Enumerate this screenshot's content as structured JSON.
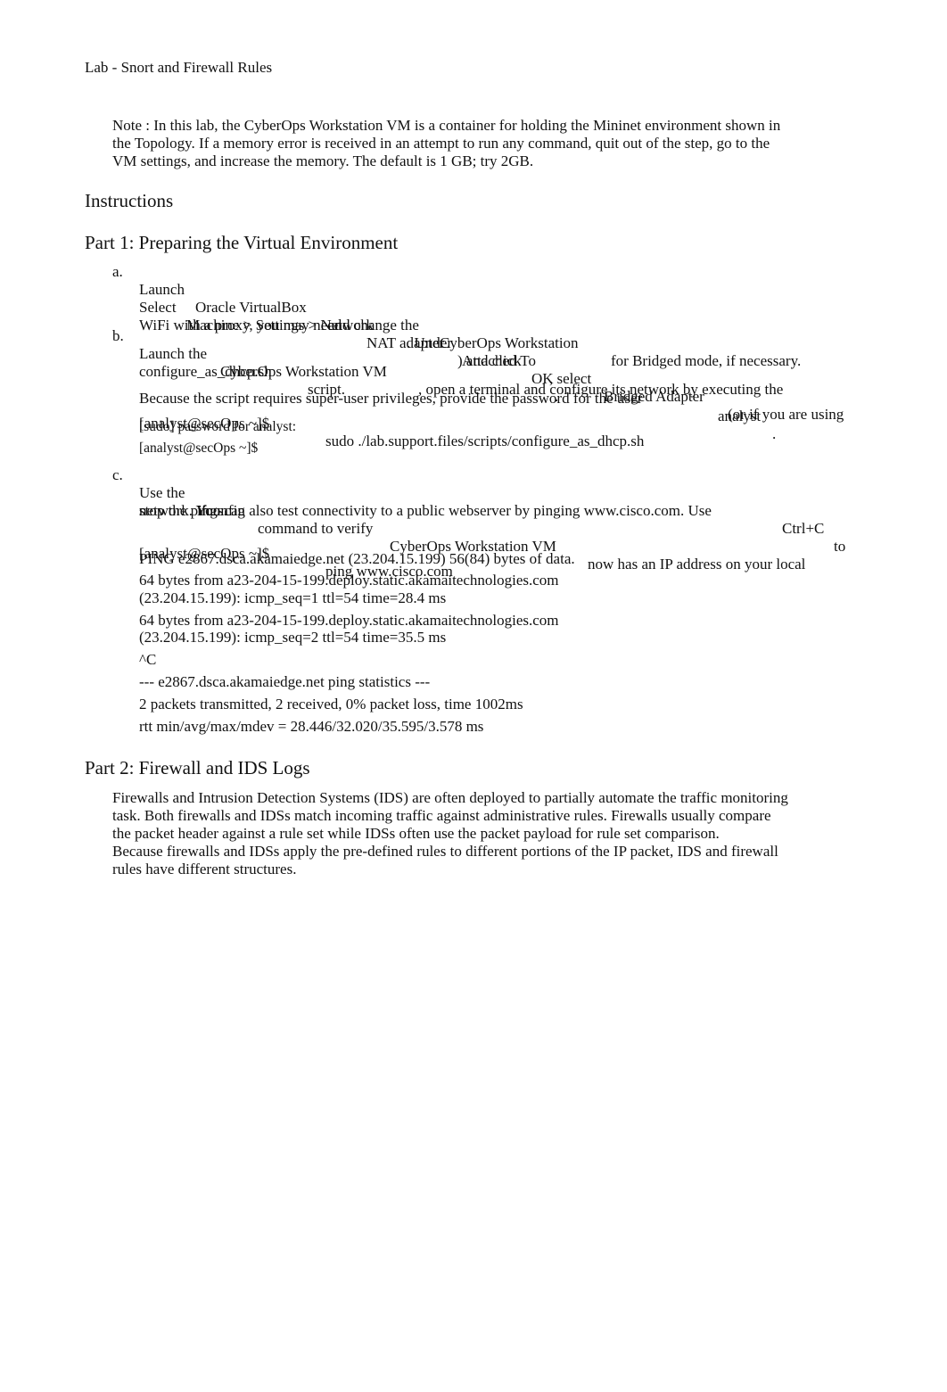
{
  "header": {
    "title": "Lab - Snort and Firewall Rules"
  },
  "note": {
    "lines": [
      "Note : In this lab, the CyberOps Workstation VM is a container for holding the Mininet environment shown in",
      "the Topology. If a memory error is received in an attempt to run any command, quit out of the step, go to the",
      "VM settings, and increase the memory. The default is 1 GB; try 2GB."
    ]
  },
  "instructions_heading": "Instructions",
  "part1": {
    "heading": "Part 1: Preparing the Virtual Environment",
    "step_a": {
      "marker": "a.",
      "line1": [
        "Launch",
        "Oracle VirtualBox",
        "and change the",
        "CyberOps Workstation",
        "for Bridged mode, if necessary."
      ],
      "line2": [
        "Select",
        "Machine > Settings > Network",
        ". Under",
        "Attached To",
        ", select",
        "Bridged Adapter",
        "(or if you are using"
      ],
      "line3": [
        "WiFi with a proxy, you may need",
        "NAT adapter",
        ") and click",
        "OK",
        "."
      ]
    },
    "step_b": {
      "marker": "b.",
      "line1": [
        "Launch the",
        "CyberOps Workstation VM",
        ", open a terminal and configure its network by executing the"
      ],
      "line2": [
        "configure_as_dhcp.sh",
        "script."
      ],
      "line3": [
        "Because the script requires super-user privileges, provide the password for the user",
        "analyst",
        "."
      ],
      "cmd_prompt": "[analyst@secOps ~]$",
      "cmd": "sudo ./lab.support.files/scripts/configure_as_dhcp.sh",
      "output1": "[sudo] password for analyst:",
      "output2": "[analyst@secOps ~]$"
    },
    "step_c": {
      "marker": "c.",
      "line1": [
        "Use the",
        "ifconfig",
        "command to verify",
        "CyberOps Workstation VM",
        "now has an IP address on your local"
      ],
      "line2": [
        "network. You can also test connectivity to a public webserver by pinging www.cisco.com. Use",
        "Ctrl+C",
        "to"
      ],
      "line3": "stop the pings.",
      "cmd_prompt": "[analyst@secOps ~]$",
      "cmd": "ping www.cisco.com",
      "output": [
        "PING e2867.dsca.akamaiedge.net (23.204.15.199) 56(84) bytes of data.",
        "64 bytes from a23-204-15-199.deploy.static.akamaitechnologies.com",
        "(23.204.15.199): icmp_seq=1 ttl=54 time=28.4 ms",
        "64 bytes from a23-204-15-199.deploy.static.akamaitechnologies.com",
        "(23.204.15.199): icmp_seq=2 ttl=54 time=35.5 ms",
        "^C",
        "--- e2867.dsca.akamaiedge.net ping statistics ---",
        "2 packets transmitted, 2 received, 0% packet loss, time 1002ms",
        "rtt min/avg/max/mdev = 28.446/32.020/35.595/3.578 ms"
      ]
    }
  },
  "part2": {
    "heading": "Part 2: Firewall and IDS Logs",
    "paragraph_lines": [
      "Firewalls and Intrusion Detection Systems (IDS) are often deployed to partially automate the traffic monitoring",
      "task. Both firewalls and IDSs match incoming traffic against administrative rules. Firewalls usually compare",
      "the packet header against a rule set while IDSs often use the packet payload for rule set comparison.",
      "Because firewalls and IDSs apply the pre-defined rules to different portions of the IP packet, IDS and firewall",
      "rules have different structures."
    ]
  }
}
